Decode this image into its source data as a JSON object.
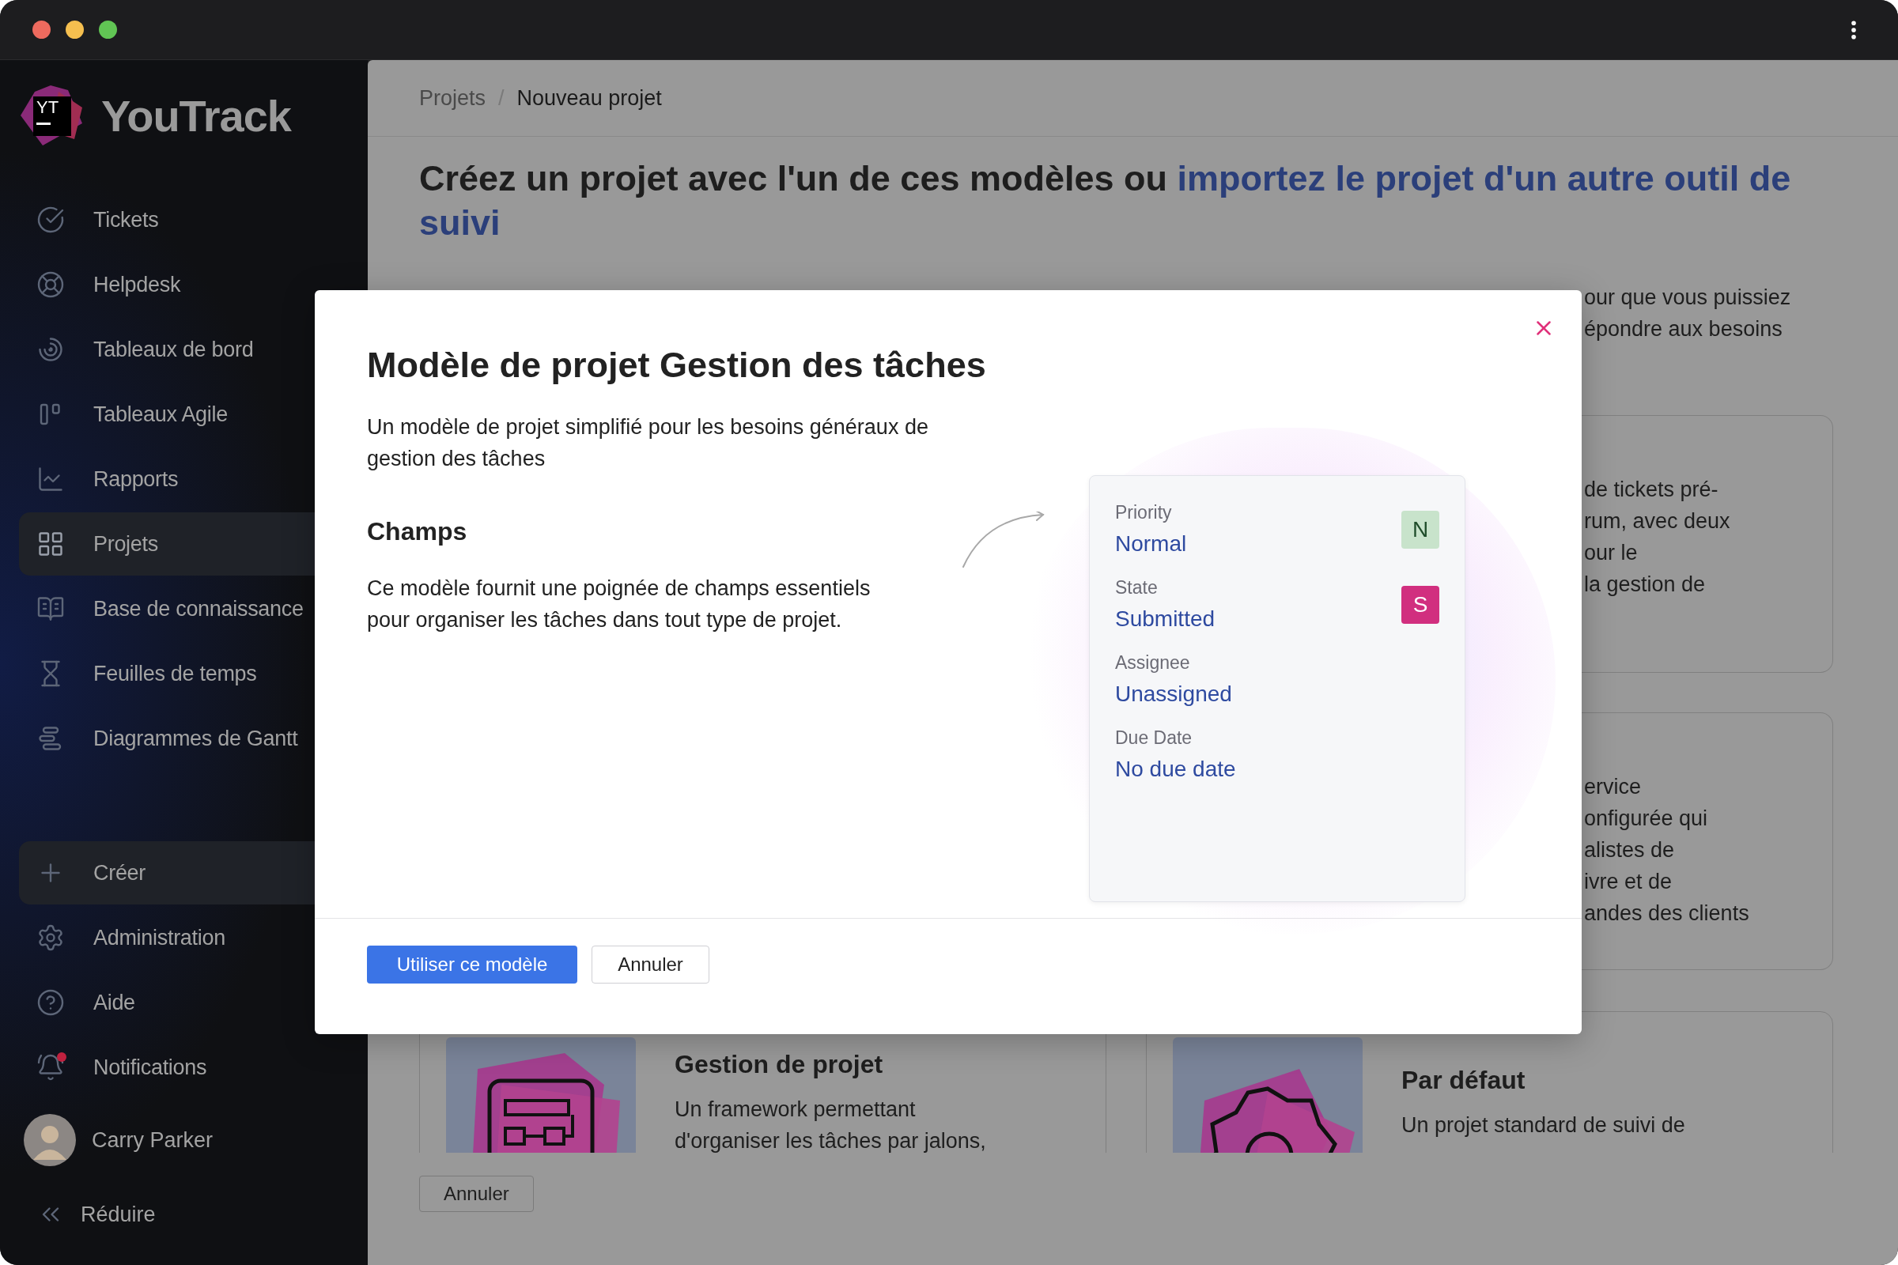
{
  "sidebar": {
    "logo": {
      "mark": "YT",
      "name": "YouTrack"
    },
    "nav_items": [
      {
        "label": "Tickets",
        "kind": "check",
        "selected": false
      },
      {
        "label": "Helpdesk",
        "kind": "lifebuoy",
        "selected": false
      },
      {
        "label": "Tableaux de bord",
        "kind": "dashboard",
        "selected": false
      },
      {
        "label": "Tableaux Agile",
        "kind": "agile",
        "selected": false
      },
      {
        "label": "Rapports",
        "kind": "reports",
        "selected": false
      },
      {
        "label": "Projets",
        "kind": "projects",
        "selected": true
      },
      {
        "label": "Base de connaissance",
        "kind": "knowledge",
        "selected": false
      },
      {
        "label": "Feuilles de temps",
        "kind": "timesheet",
        "selected": false
      },
      {
        "label": "Diagrammes de Gantt",
        "kind": "gantt",
        "selected": false
      }
    ],
    "bottom_items": [
      {
        "label": "Créer",
        "kind": "create",
        "selected": true,
        "unread": false
      },
      {
        "label": "Administration",
        "kind": "admin",
        "selected": false,
        "unread": false
      },
      {
        "label": "Aide",
        "kind": "help",
        "selected": false,
        "unread": false
      },
      {
        "label": "Notifications",
        "kind": "notifications",
        "selected": false,
        "unread": true
      }
    ],
    "user": {
      "name": "Carry Parker"
    },
    "collapse": {
      "label": "Réduire"
    }
  },
  "breadcrumb": {
    "separator": "/",
    "items": [
      {
        "label": "Projets",
        "current": false
      },
      {
        "label": "Nouveau projet",
        "current": true
      }
    ]
  },
  "heading": {
    "text": "Créez un projet avec l'un de ces modèles ou ",
    "link_lines": [
      "importez le projet d'un autre outil de",
      "suivi"
    ]
  },
  "intro_fragments": [
    "our que vous puissiez",
    "épondre aux besoins"
  ],
  "template_cards": [
    {
      "lines": [
        "de tickets pré-",
        "rum, avec deux",
        "our le",
        "la gestion de"
      ]
    },
    {
      "lines": [
        "ervice",
        "onfigurée qui",
        "alistes de",
        "ivre et de",
        "andes des clients"
      ]
    }
  ],
  "bottom_cards": [
    {
      "title": "Gestion de projet",
      "lines": [
        "Un framework permettant",
        "d'organiser les tâches par jalons,"
      ],
      "kind": "flowchart"
    },
    {
      "title": "Par défaut",
      "lines": [
        "Un projet standard de suivi de"
      ],
      "kind": "seal"
    }
  ],
  "cancel_button": "Annuler",
  "dialog": {
    "title": "Modèle de projet Gestion des tâches",
    "description": "Un modèle de projet simplifié pour les besoins généraux de gestion des tâches",
    "section_title": "Champs",
    "section_text": "Ce modèle fournit une poignée de champs essentiels pour organiser les tâches dans tout type de projet.",
    "fields": [
      {
        "label": "Priority",
        "value": "Normal",
        "badge": "N",
        "color": "#c8e3cb"
      },
      {
        "label": "State",
        "value": "Submitted",
        "badge": "S",
        "color": "#d12f7f"
      },
      {
        "label": "Assignee",
        "value": "Unassigned"
      },
      {
        "label": "Due Date",
        "value": "No due date"
      }
    ],
    "primary_button": "Utiliser ce modèle",
    "cancel_button": "Annuler"
  }
}
